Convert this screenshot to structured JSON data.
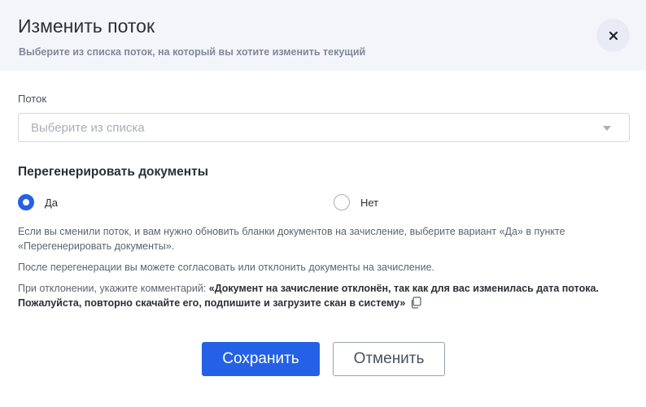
{
  "header": {
    "title": "Изменить поток",
    "subtitle": "Выберите из списка поток, на который вы хотите изменить текущий"
  },
  "close_icon": "close-icon",
  "stream_field": {
    "label": "Поток",
    "placeholder": "Выберите из списка"
  },
  "regenerate": {
    "title": "Перегенерировать документы",
    "options": [
      {
        "label": "Да",
        "selected": true
      },
      {
        "label": "Нет",
        "selected": false
      }
    ]
  },
  "info": {
    "p1": "Если вы сменили поток, и вам нужно обновить бланки документов на зачисление, выберите вариант «Да» в пункте «Перегенерировать документы».",
    "p2": "После перегенерации вы можете согласовать или отклонить документы на зачисление.",
    "p3_prefix": "При отклонении, укажите комментарий: ",
    "p3_quote": "«Документ на зачисление отклонён, так как для вас изменилась дата потока. Пожалуйста, повторно скачайте его, подпишите и загрузите скан в систему»"
  },
  "buttons": {
    "save": "Сохранить",
    "cancel": "Отменить"
  },
  "colors": {
    "accent": "#2461e6",
    "header_bg": "#f3f5fb"
  }
}
